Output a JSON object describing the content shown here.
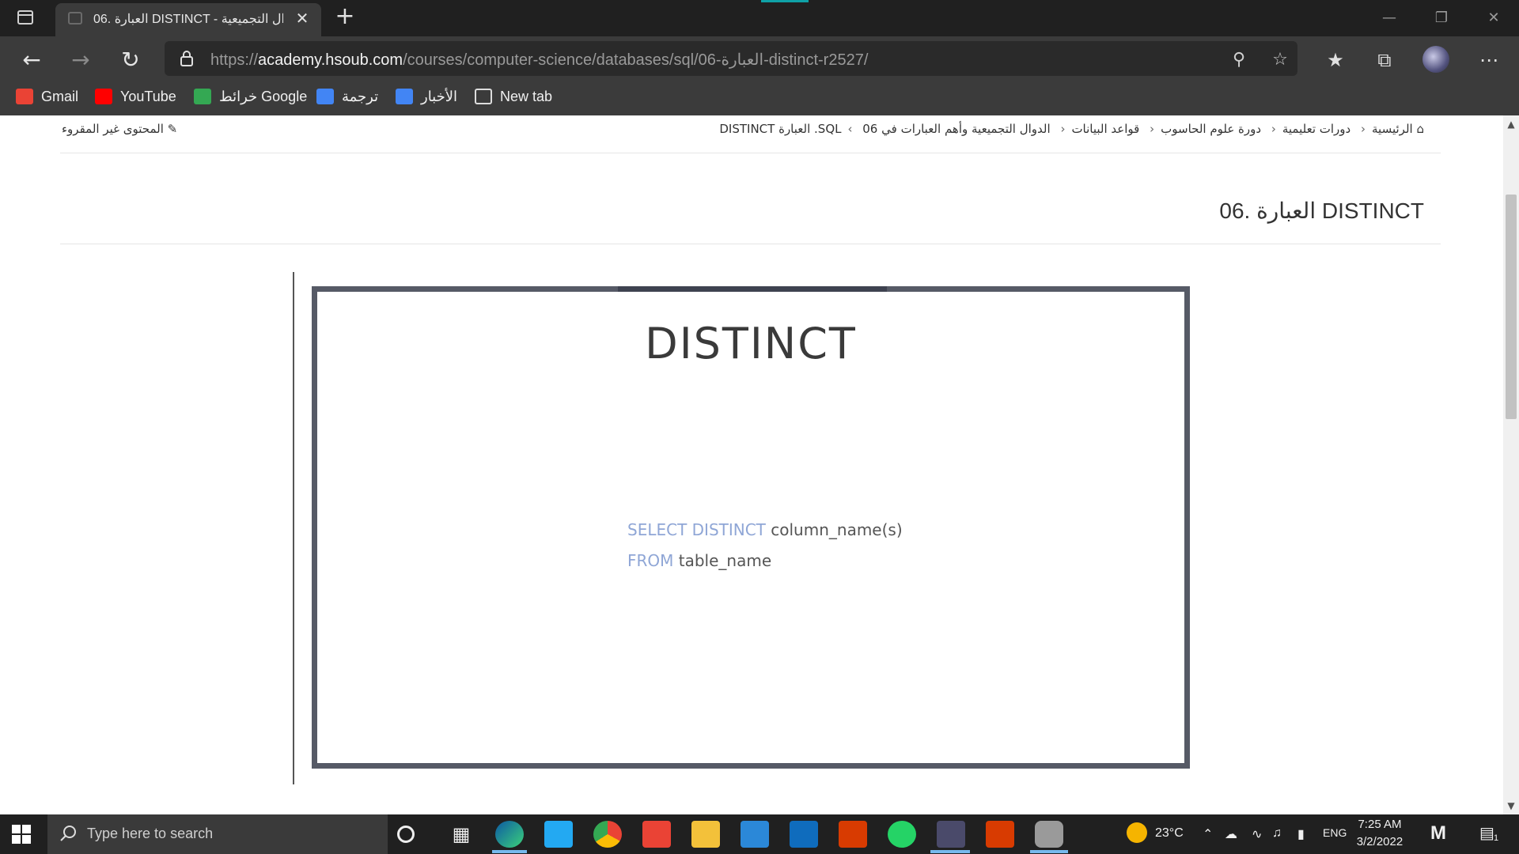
{
  "browser": {
    "tab_title": "06. العبارة DISTINCT - الدوال التجميعية",
    "close_glyph": "✕",
    "new_tab_glyph": "+",
    "url_prefix": "https://",
    "url_host": "academy.hsoub.com",
    "url_path": "/courses/computer-science/databases/sql/06-العبارة-distinct-r2527/"
  },
  "bookmarks": [
    {
      "label": "Gmail",
      "color": "#ea4335"
    },
    {
      "label": "YouTube",
      "color": "#ff0000"
    },
    {
      "label": "خرائط Google",
      "color": "#34a853"
    },
    {
      "label": "ترجمة",
      "color": "#4285f4"
    },
    {
      "label": "الأخبار",
      "color": "#4285f4"
    },
    {
      "label": "New tab",
      "color": "#dddddd"
    }
  ],
  "page": {
    "breadcrumb": [
      "الرئيسية",
      "دورات تعليمية",
      "دورة علوم الحاسوب",
      "قواعد البيانات",
      "الدوال التجميعية وأهم العبارات في SQL",
      "06. العبارة DISTINCT"
    ],
    "unread_label": "المحتوى غير المقروء",
    "title": "06. العبارة DISTINCT",
    "slide_title": "DISTINCT",
    "code_kw1": "SELECT DISTINCT",
    "code_rest1": "column_name(s)",
    "code_kw2": "FROM",
    "code_rest2": "table_name"
  },
  "taskbar": {
    "search_placeholder": "Type here to search",
    "temperature": "23°C",
    "language": "ENG",
    "time": "7:25 AM",
    "date": "3/2/2022",
    "notification_count": "1"
  },
  "colors": {
    "keyword": "#8fa6d6",
    "slide_border": "#565a66",
    "accent": "#0fa1a6"
  }
}
